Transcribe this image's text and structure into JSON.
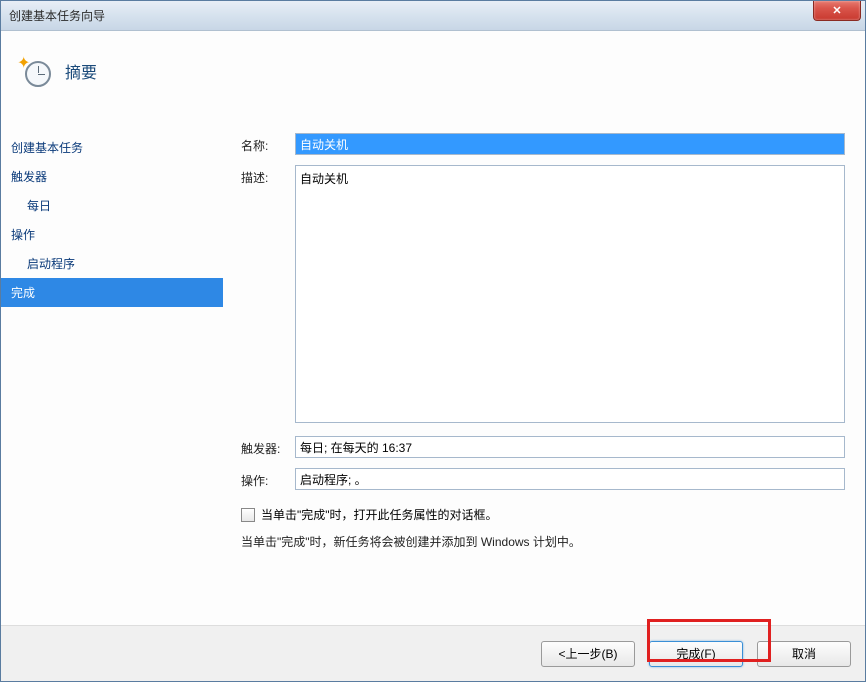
{
  "titlebar": {
    "title": "创建基本任务向导"
  },
  "header": {
    "title": "摘要"
  },
  "sidebar": {
    "items": [
      {
        "label": "创建基本任务",
        "indent": false
      },
      {
        "label": "触发器",
        "indent": false
      },
      {
        "label": "每日",
        "indent": true
      },
      {
        "label": "操作",
        "indent": false
      },
      {
        "label": "启动程序",
        "indent": true
      },
      {
        "label": "完成",
        "indent": false,
        "active": true
      }
    ]
  },
  "form": {
    "name_label": "名称:",
    "name_value": "自动关机",
    "desc_label": "描述:",
    "desc_value": "自动关机",
    "trigger_label": "触发器:",
    "trigger_value": "每日; 在每天的 16:37",
    "action_label": "操作:",
    "action_value": "启动程序; 。"
  },
  "footer": {
    "checkbox_label": "当单击\"完成\"时，打开此任务属性的对话框。",
    "info_text": "当单击\"完成\"时，新任务将会被创建并添加到 Windows 计划中。"
  },
  "buttons": {
    "back": "<上一步(B)",
    "finish": "完成(F)",
    "cancel": "取消"
  }
}
